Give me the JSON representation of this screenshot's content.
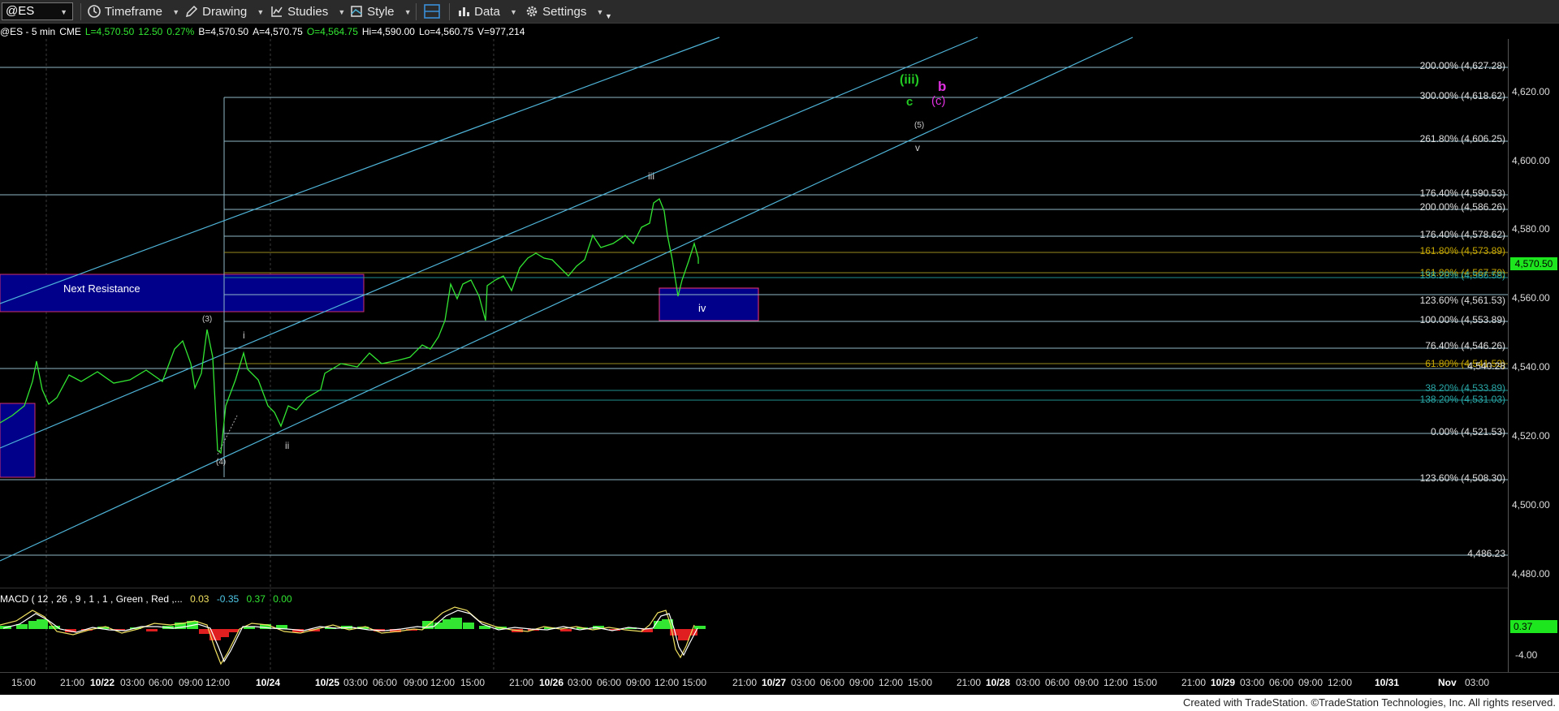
{
  "toolbar": {
    "symbol": "@ES",
    "timeframe_label": "Timeframe",
    "drawing_label": "Drawing",
    "studies_label": "Studies",
    "style_label": "Style",
    "data_label": "Data",
    "settings_label": "Settings"
  },
  "infobar": {
    "symbol": "@ES - 5 min",
    "exchange": "CME",
    "last": "L=4,570.50",
    "change": "12.50",
    "pct": "0.27%",
    "bid": "B=4,570.50",
    "ask": "A=4,570.75",
    "open": "O=4,564.75",
    "high": "Hi=4,590.00",
    "low": "Lo=4,560.75",
    "volume": "V=977,214"
  },
  "price_axis": {
    "ticks": [
      "4,620.00",
      "4,600.00",
      "4,580.00",
      "4,560.00",
      "4,540.00",
      "4,520.00",
      "4,500.00",
      "4,480.00"
    ],
    "current_price": "4,570.50"
  },
  "fib_levels": [
    {
      "label": "200.00% (4,627.28)",
      "color": "#e0e0e0"
    },
    {
      "label": "300.00% (4,618.62)",
      "color": "#e0e0e0"
    },
    {
      "label": "261.80% (4,606.25)",
      "color": "#e0e0e0"
    },
    {
      "label": "176.40% (4,590.53)",
      "color": "#e0e0e0"
    },
    {
      "label": "200.00% (4,586.26)",
      "color": "#e0e0e0"
    },
    {
      "label": "176.40% (4,578.62)",
      "color": "#e0e0e0"
    },
    {
      "label": "161.80% (4,573.89)",
      "color": "#c8a800"
    },
    {
      "label": "161.80% (4,567.79)",
      "color": "#c8a800"
    },
    {
      "label": "138.20% (4,566.58)",
      "color": "#2aa8a8"
    },
    {
      "label": "123.60% (4,561.53)",
      "color": "#e0e0e0"
    },
    {
      "label": "100.00% (4,553.89)",
      "color": "#e0e0e0"
    },
    {
      "label": "76.40% (4,546.26)",
      "color": "#e0e0e0"
    },
    {
      "label": "61.80% (4,541.53)",
      "color": "#c8a800"
    },
    {
      "label": "4,540.28",
      "color": "#e0e0e0"
    },
    {
      "label": "38.20% (4,533.89)",
      "color": "#2aa8a8"
    },
    {
      "label": "138.20% (4,531.03)",
      "color": "#2aa8a8"
    },
    {
      "label": "0.00% (4,521.53)",
      "color": "#e0e0e0"
    },
    {
      "label": "123.60% (4,508.30)",
      "color": "#e0e0e0"
    },
    {
      "label": "4,486.23",
      "color": "#e0e0e0"
    }
  ],
  "wave_labels": {
    "iii_green": "(iii)",
    "c_green": "c",
    "b_magenta": "b",
    "c_magenta": "(c)",
    "five": "(5)",
    "v": "v",
    "iii": "iii",
    "iv": "iv",
    "three": "(3)",
    "i": "i",
    "four": "(4)",
    "ii": "ii"
  },
  "zones": {
    "next_resistance": "Next Resistance"
  },
  "macd": {
    "label": "MACD ( 12 , 26 , 9 , 1 , 1 , Green , Red ,...",
    "v1": "0.03",
    "v2": "-0.35",
    "v3": "0.37",
    "v4": "0.00",
    "axis_top": "0.37",
    "axis_bottom": "-4.00"
  },
  "time_axis": [
    "15:00",
    "21:00",
    "10/22",
    "03:00",
    "06:00",
    "09:00",
    "12:00",
    "10/24",
    "10/25",
    "03:00",
    "06:00",
    "09:00",
    "12:00",
    "15:00",
    "21:00",
    "10/26",
    "03:00",
    "06:00",
    "09:00",
    "12:00",
    "15:00",
    "21:00",
    "10/27",
    "03:00",
    "06:00",
    "09:00",
    "12:00",
    "15:00",
    "21:00",
    "10/28",
    "03:00",
    "06:00",
    "09:00",
    "12:00",
    "15:00",
    "21:00",
    "10/29",
    "03:00",
    "06:00",
    "09:00",
    "12:00",
    "10/31",
    "Nov",
    "03:00"
  ],
  "footer": "Created with TradeStation. ©TradeStation Technologies, Inc. All rights reserved.",
  "colors": {
    "background": "#000000",
    "channel": "#4fb4d8",
    "price": "#32e632",
    "wave_green": "#22c922",
    "wave_magenta": "#e030e0",
    "zone_fill": "#00008b",
    "zone_border": "#d0306a"
  }
}
